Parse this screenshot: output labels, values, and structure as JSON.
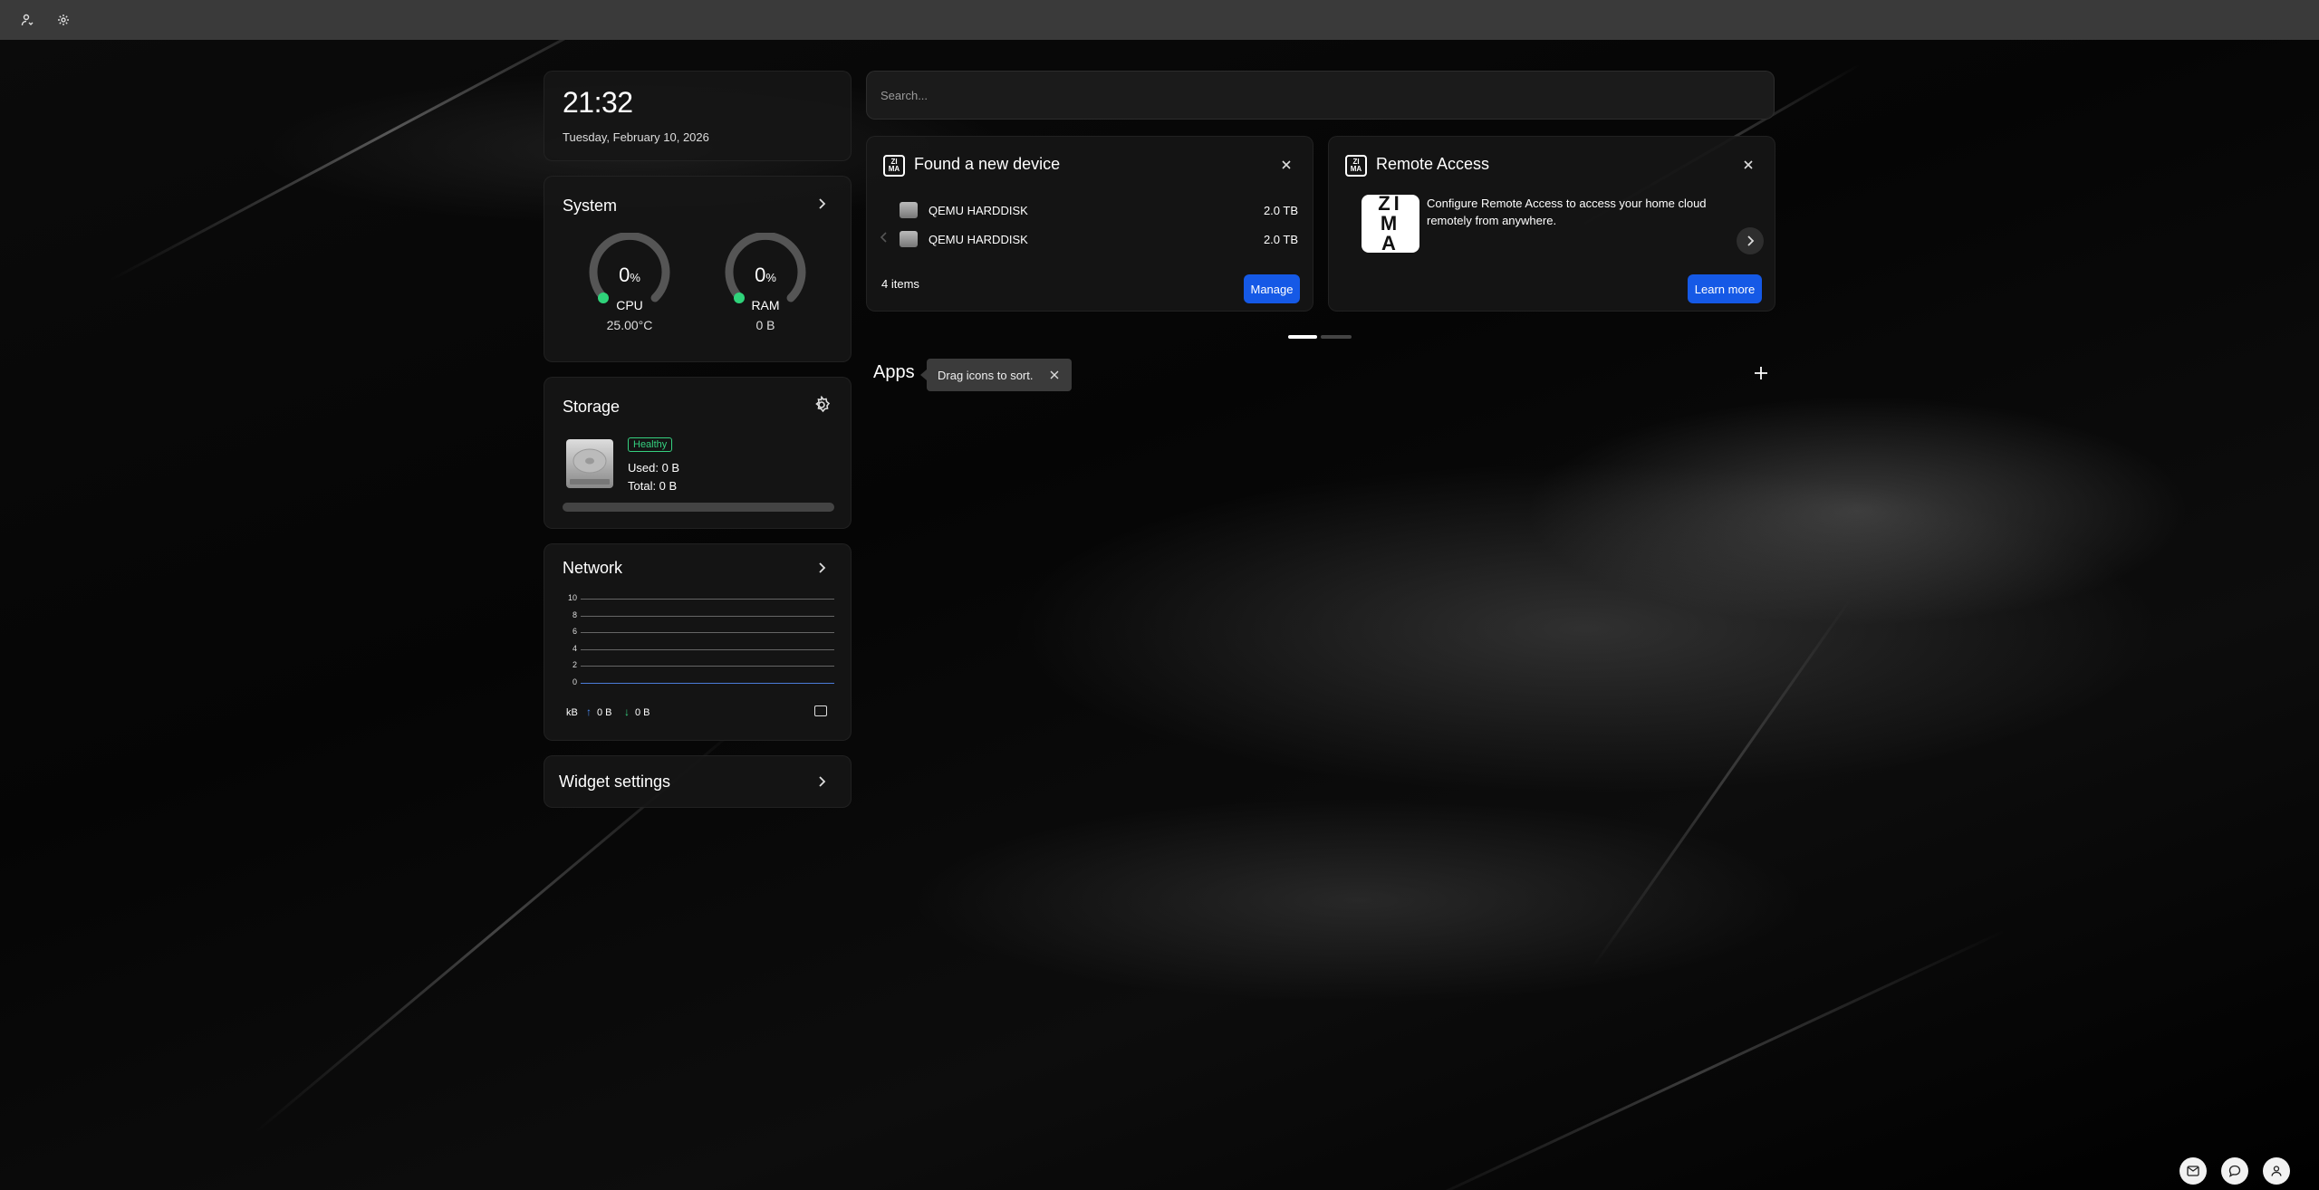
{
  "clock": {
    "time": "21:32",
    "date": "Tuesday, February 10, 2026"
  },
  "system": {
    "title": "System",
    "cpu": {
      "value": "0",
      "unit": "%",
      "label": "CPU",
      "sub": "25.00°C"
    },
    "ram": {
      "value": "0",
      "unit": "%",
      "label": "RAM",
      "sub": "0 B"
    }
  },
  "storage": {
    "title": "Storage",
    "status": "Healthy",
    "used": "Used: 0 B",
    "total": "Total: 0 B",
    "usage_fraction": 0
  },
  "network": {
    "title": "Network",
    "unit": "kB",
    "upload": "0 B",
    "download": "0 B",
    "y_ticks": [
      "10",
      "8",
      "6",
      "4",
      "2",
      "0"
    ]
  },
  "widget_settings": {
    "label": "Widget settings"
  },
  "search": {
    "placeholder": "Search..."
  },
  "notifications": {
    "device": {
      "title": "Found a new device",
      "items": [
        {
          "name": "QEMU HARDDISK",
          "size": "2.0 TB"
        },
        {
          "name": "QEMU HARDDISK",
          "size": "2.0 TB"
        }
      ],
      "count": "4 items",
      "button": "Manage"
    },
    "remote": {
      "title": "Remote Access",
      "logo_text": "ZIMA",
      "text": "Configure Remote Access to access your home cloud remotely from anywhere.",
      "button": "Learn more"
    }
  },
  "apps": {
    "label": "Apps",
    "tooltip": "Drag icons to sort."
  },
  "colors": {
    "accent": "#1559e6",
    "healthy": "#35d07f",
    "gauge_dot": "#2fd37a"
  }
}
